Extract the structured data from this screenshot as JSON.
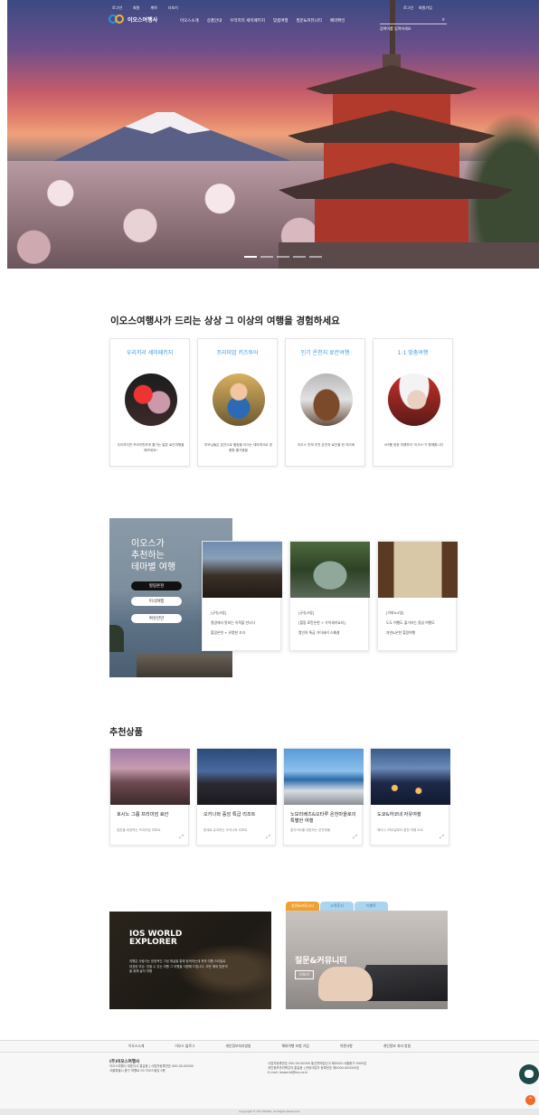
{
  "top_links": [
    "로그인",
    "회원",
    "계약",
    "더보기"
  ],
  "top_right": [
    "로그인",
    "회원가입"
  ],
  "logo_text": "이오스여행사",
  "nav": [
    "이오스소개",
    "상품안내",
    "우리끼리 세미패키지",
    "맞춤여행",
    "질문&커뮤니티",
    "예약확인"
  ],
  "search": {
    "placeholder": "검색어를 입력하세요"
  },
  "section1": {
    "title": "이오스여행사가 드리는 상상 그 이상의 여행을 경험하세요",
    "cards": [
      {
        "title": "우리끼리 세미패키지",
        "desc": "우리끼리만 프라이빗하게 즐기는 일본 료칸여행을 해보세요!"
      },
      {
        "title": "프리미엄 키즈투어",
        "desc": "부모님들은 온천으로 힐링을 아이는 테마파크로 맞춤형 즐거움을"
      },
      {
        "title": "인기 온천지 료칸여행",
        "desc": "이오스 전체 추천 온천과 료칸을 한 자리에"
      },
      {
        "title": "1:1 맞춤여행",
        "desc": "VIP를 위한 여행부터 '이오스'가 함께합니다"
      }
    ]
  },
  "theme": {
    "title_line1": "이오스가",
    "title_line2": "추천하는",
    "title_line3": "테마별 여행",
    "buttons": [
      "힐링온천",
      "미식여행",
      "여유만만"
    ],
    "cards": [
      {
        "l1": "[규슈/3일]",
        "l2": "절경에서 맛보는 유적을 만나다",
        "l3": "힐링온천 + 유명한 조식"
      },
      {
        "l1": "[규슈/3일]",
        "l2": "[힐링 료칸온천 + 가이세키요리]",
        "l3": "명인의 특급 가이세키 스페셜"
      },
      {
        "l1": "[이와노4일]",
        "l2": "도도 여행도 즐기라는 정성 여행도",
        "l3": "자연&온천 힐링여행"
      }
    ]
  },
  "recommend": {
    "title": "추천상품",
    "cards": [
      {
        "name": "호시노 그룹 프리미엄 료칸",
        "sub": "일본을 대표하는 프리미엄 리조트"
      },
      {
        "name": "오키나와 중앙 특급 리조트",
        "sub": "현재로 유지하는 오키나와 리조트"
      },
      {
        "name": "노보리베츠&오타루 온천마을로의 특별한 여행",
        "sub": "홋카이도를 대표하는 온천마을"
      },
      {
        "name": "도쿄&하코네 자유여행",
        "sub": "메디나 2박4일부터 알찬 여행 도쿄"
      }
    ]
  },
  "ios": {
    "title": "IOS WORLD EXPLORER",
    "desc": "여행은 사람이는 한정적인 그림 채널을 통해 탐색하는데 최적 여행 스타일로 대표한 여성. 믿을 수 있는 여행 그 여행을 지원해 드립니다. 모든 해외 방문객을 위해 솔직 여행"
  },
  "qa": {
    "tabs": [
      "질문&커뮤니티",
      "고객후기",
      "이벤트"
    ],
    "title": "질문&커뮤니티",
    "more": "더보기"
  },
  "footer_nav": [
    "이오스소개",
    "이오스 블로그",
    "개인정보처리방침",
    "해외여행 보험 가입",
    "약관사항",
    "개인정보 처리 방침"
  ],
  "footer": {
    "company": "(주)이오스여행사",
    "line1": "이오스여행사 대표이사 홍길동 | 사업자등록번호 000-00-00000",
    "line2": "서울특별시 중구 여행로 00 이오스빌딩 0층",
    "right1": "사업자등록번호 000-00-00000 통신판매업신고 제0000-서울중구-0000호",
    "right2": "개인정보관리책임자 홍길동 | 관광사업자 등록번호 제0000-000000호",
    "right3": "E-mail: iosworld@ios.co.kr"
  },
  "copyright": "Copyright © IOS TRAVEL All Rights Reserved."
}
